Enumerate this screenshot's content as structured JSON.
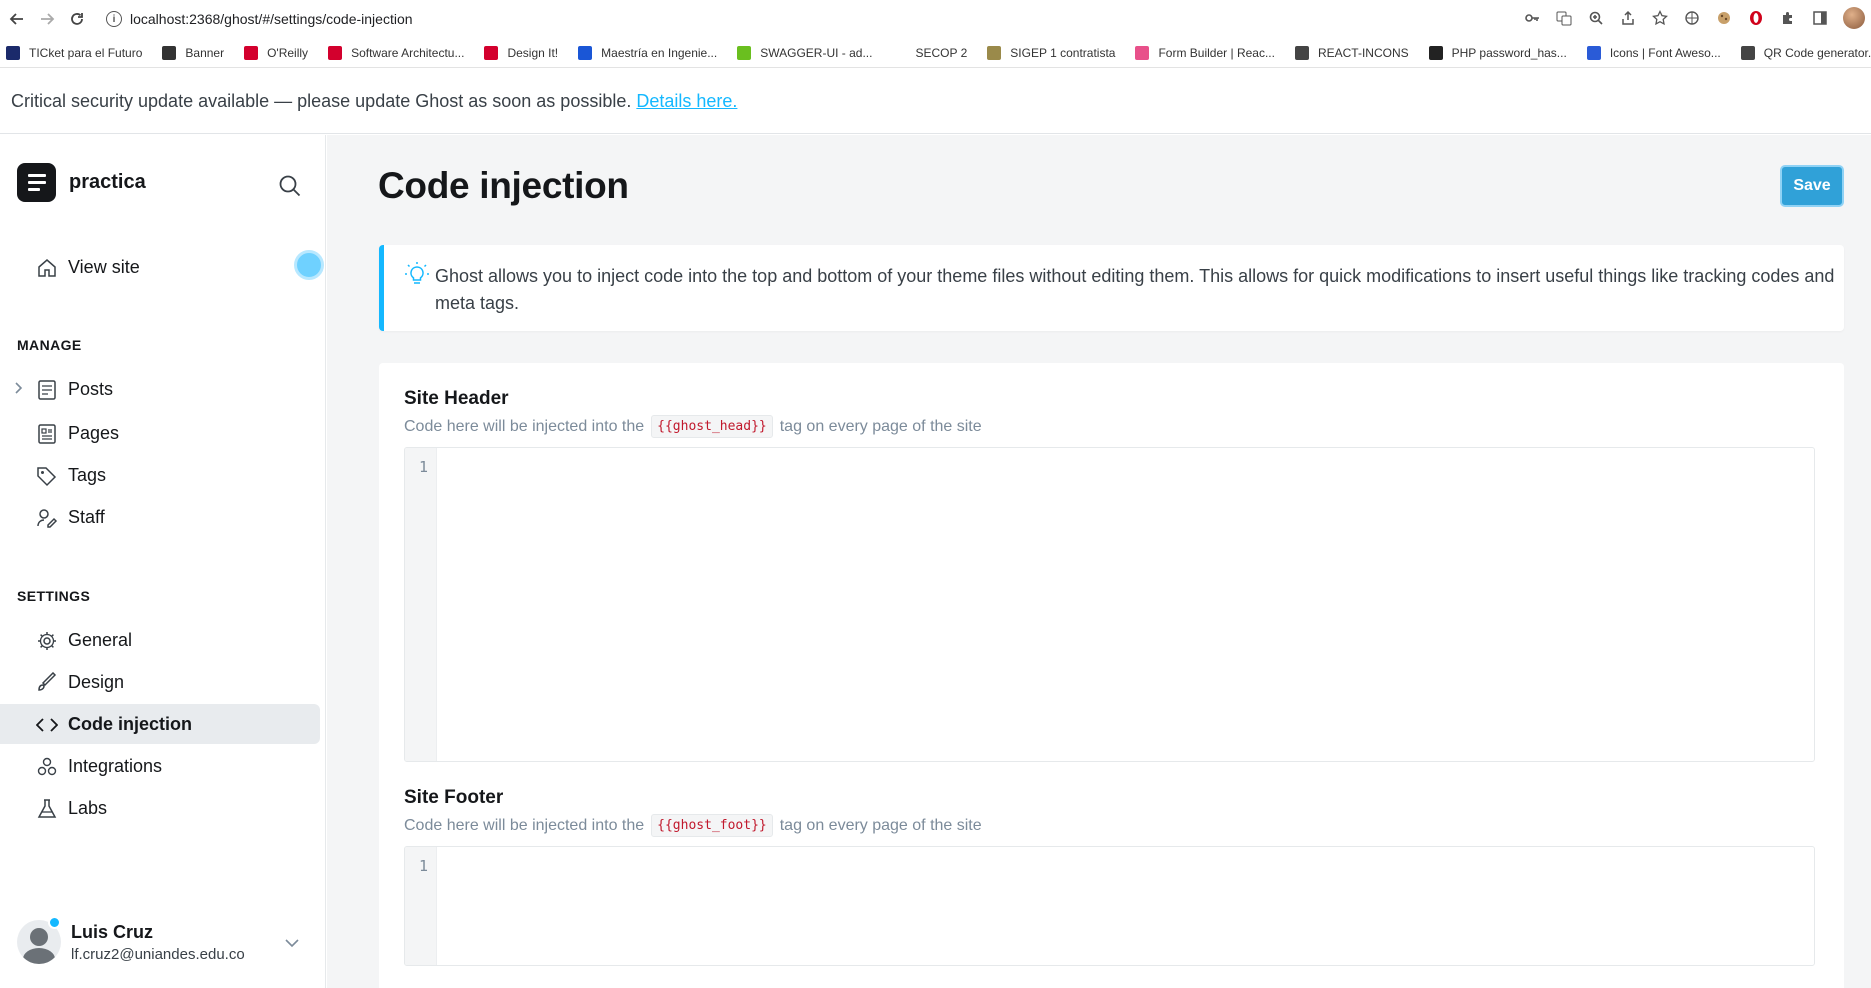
{
  "browser": {
    "url": "localhost:2368/ghost/#/settings/code-injection",
    "bookmarks": [
      {
        "label": "TICket para el Futuro",
        "color": "#1b2a6b"
      },
      {
        "label": "Banner",
        "color": "#333333"
      },
      {
        "label": "O'Reilly",
        "color": "#d3002d"
      },
      {
        "label": "Software Architectu...",
        "color": "#d3002d"
      },
      {
        "label": "Design It!",
        "color": "#d3002d"
      },
      {
        "label": "Maestría en Ingenie...",
        "color": "#1a56d6"
      },
      {
        "label": "SWAGGER-UI - ad...",
        "color": "#6abf1f"
      },
      {
        "label": "SECOP 2",
        "color": "#ffffff"
      },
      {
        "label": "SIGEP 1 contratista",
        "color": "#9a8a4a"
      },
      {
        "label": "Form Builder | Reac...",
        "color": "#e8508a"
      },
      {
        "label": "REACT-INCONS",
        "color": "#444444"
      },
      {
        "label": "PHP password_has...",
        "color": "#222222"
      },
      {
        "label": "Icons | Font Aweso...",
        "color": "#2a5bd7"
      },
      {
        "label": "QR Code generator...",
        "color": "#444444"
      }
    ]
  },
  "banner": {
    "text": "Critical security update available — please update Ghost as soon as possible.",
    "link": "Details here."
  },
  "sidebar": {
    "brand": "practica",
    "view_site": "View site",
    "manage_label": "MANAGE",
    "manage_items": [
      "Posts",
      "Pages",
      "Tags",
      "Staff"
    ],
    "settings_label": "SETTINGS",
    "settings_items": [
      "General",
      "Design",
      "Code injection",
      "Integrations",
      "Labs"
    ],
    "user": {
      "name": "Luis Cruz",
      "email": "lf.cruz2@uniandes.edu.co"
    }
  },
  "main": {
    "title": "Code injection",
    "save": "Save",
    "info": "Ghost allows you to inject code into the top and bottom of your theme files without editing them. This allows for quick modifications to insert useful things like tracking codes and meta tags.",
    "header": {
      "title": "Site Header",
      "sub_before": "Code here will be injected into the",
      "tag": "{{ghost_head}}",
      "sub_after": "tag on every page of the site",
      "line": "1"
    },
    "footer": {
      "title": "Site Footer",
      "sub_before": "Code here will be injected into the",
      "tag": "{{ghost_foot}}",
      "sub_after": "tag on every page of the site",
      "line": "1"
    }
  },
  "colors": {
    "accent": "#14b8ff",
    "save": "#30a1d8",
    "code": "#c1182c"
  }
}
